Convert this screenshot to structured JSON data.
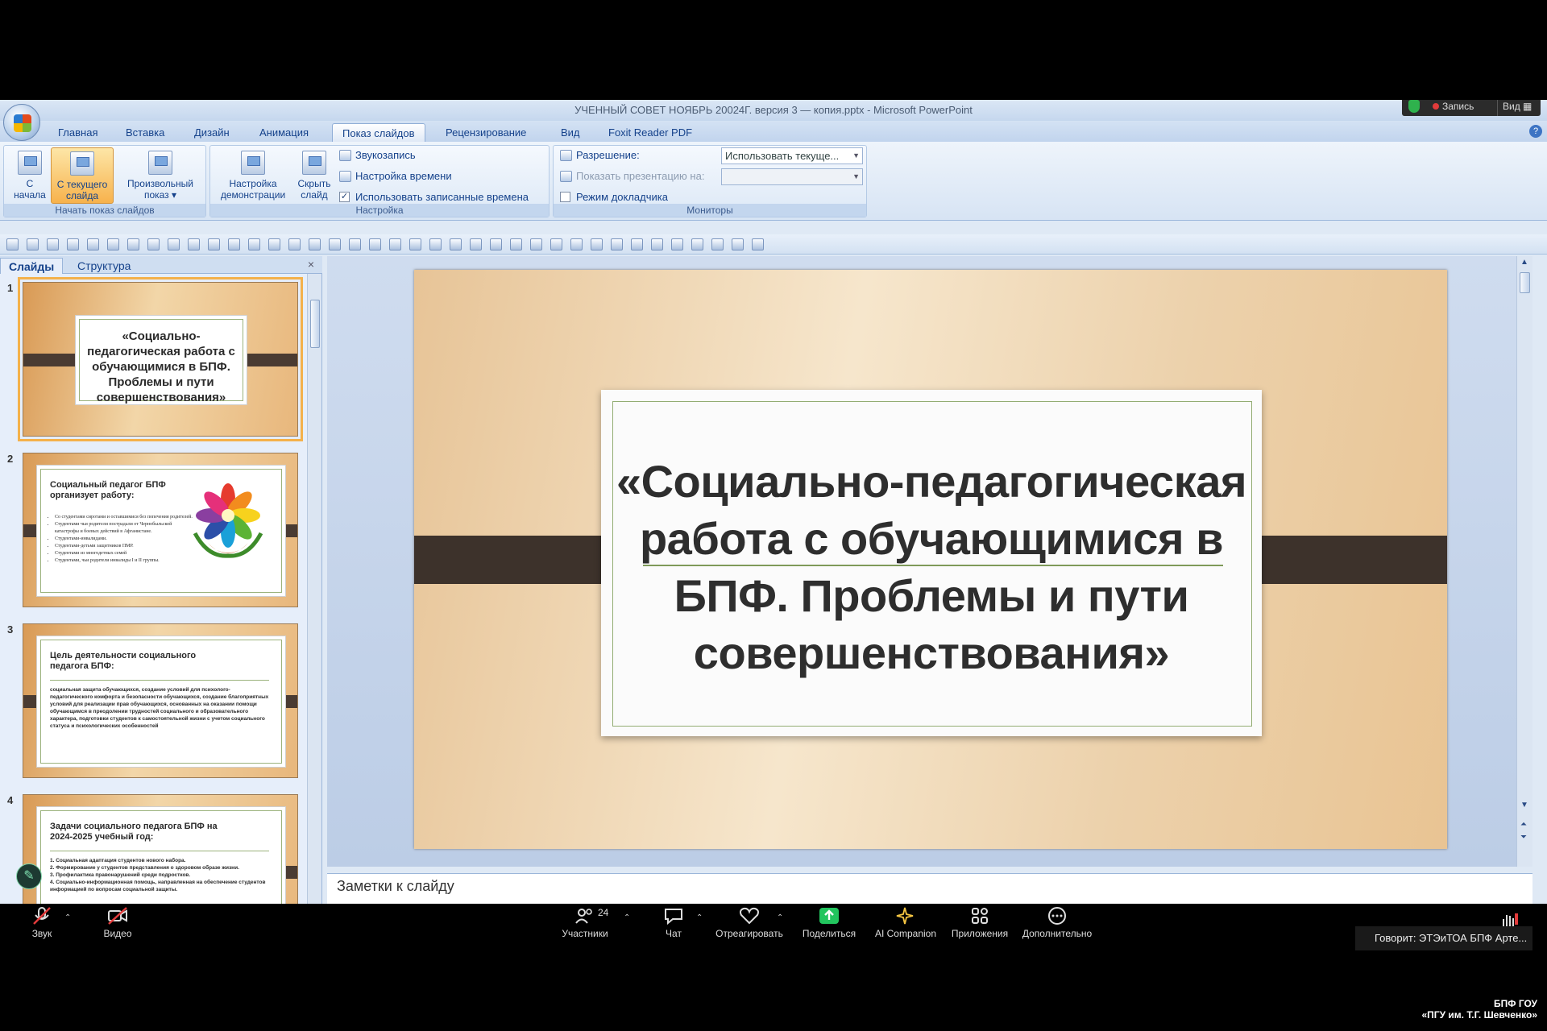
{
  "window": {
    "title": "УЧЕННЫЙ СОВЕТ НОЯБРЬ 20024Г. версия 3 — копия.pptx - Microsoft PowerPoint"
  },
  "ribbon_tabs": [
    "Главная",
    "Вставка",
    "Дизайн",
    "Анимация",
    "Показ слайдов",
    "Рецензирование",
    "Вид",
    "Foxit Reader PDF"
  ],
  "ribbon": {
    "start_group": {
      "label": "Начать показ слайдов",
      "from_start_l1": "С",
      "from_start_l2": "начала",
      "from_current_l1": "С текущего",
      "from_current_l2": "слайда",
      "custom_l1": "Произвольный",
      "custom_l2": "показ ▾"
    },
    "setup_group": {
      "label": "Настройка",
      "setup_l1": "Настройка",
      "setup_l2": "демонстрации",
      "hide_l1": "Скрыть",
      "hide_l2": "слайд",
      "record": "Звукозапись",
      "timings": "Настройка времени",
      "use_timings": "Использовать записанные времена"
    },
    "monitors_group": {
      "label": "Мониторы",
      "resolution_label": "Разрешение:",
      "resolution_value": "Использовать текуще...",
      "show_on_label": "Показать презентацию на:",
      "presenter_view": "Режим докладчика"
    }
  },
  "left_pane": {
    "tab_slides": "Слайды",
    "tab_outline": "Структура",
    "close": "×"
  },
  "thumbnails": [
    {
      "num": "1",
      "title": "«Социально-педагогическая работа с обучающимися в БПФ. Проблемы и пути совершенствования»"
    },
    {
      "num": "2",
      "title": "Социальный педагог БПФ организует работу:",
      "items": [
        "Со студентами сиротами и оставшимися без попечения родителей.",
        "Студентами чьи родители пострадали от Чернобыльской катастрофы и боевых действий в Афганистане.",
        "Студентами-инвалидами.",
        "Студентами-детьми защитников ПМР.",
        "Студентами из многодетных семей",
        "Студентами, чьи родители инвалиды I и II группы."
      ]
    },
    {
      "num": "3",
      "title": "Цель деятельности социального педагога БПФ:",
      "body": "социальная защита обучающихся, создание условий для психолого-педагогического комфорта и безопасности обучающихся, создание благоприятных условий для реализации прав обучающихся, основанных на оказании помощи обучающимся в преодолении трудностей социального и образовательного характера, подготовки студентов к самостоятельной жизни с учетом социального статуса и психологических особенностей"
    },
    {
      "num": "4",
      "title": "Задачи социального педагога БПФ на 2024-2025  учебный год:",
      "items": [
        "1. Социальная адаптация студентов нового набора.",
        "2. Формирование у студентов представления о здоровом образе жизни.",
        "3. Профилактика правонарушений среди подростков.",
        "4. Социально-информационная помощь, направленная на обеспечение студентов информацией по вопросам социальной защиты."
      ]
    }
  ],
  "slide": {
    "title": "«Социально-педагогическая работа с обучающимися в БПФ. Проблемы и пути совершенствования»"
  },
  "notes": {
    "placeholder": "Заметки к слайду"
  },
  "overlay": {
    "recording": "Запись",
    "view": "Вид ▦"
  },
  "zoom_bar": {
    "audio": "Звук",
    "video": "Видео",
    "participants": "Участники",
    "participants_count": "24",
    "chat": "Чат",
    "react": "Отреагировать",
    "share": "Поделиться",
    "ai": "AI Companion",
    "apps": "Приложения",
    "more": "Дополнительно",
    "speaking": "Говорит: ЭТЭиТОА БПФ Арте..."
  },
  "watermark": {
    "line1": "БПФ ГОУ",
    "line2": "«ПГУ им. Т.Г. Шевченко»"
  },
  "colors": {
    "ribbon_text": "#15428b",
    "active_button": "#f7b24c",
    "slide_bar": "#3d322b",
    "card_border": "#93ad73"
  }
}
